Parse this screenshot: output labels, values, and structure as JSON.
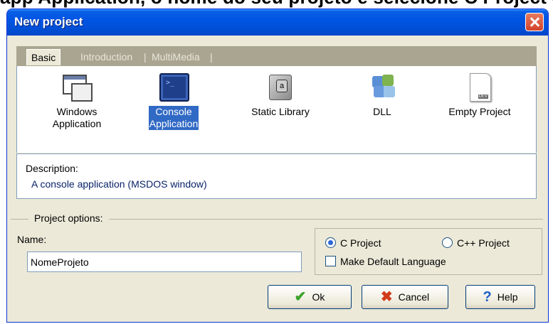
{
  "caption": "app Application, o nome do seu projeto e selecione C Project e clique em OK.",
  "dialog": {
    "title": "New project",
    "tabs": [
      "Basic",
      "Introduction",
      "MultiMedia"
    ],
    "items": [
      {
        "label": "Windows\nApplication",
        "icon": "windows-application-icon"
      },
      {
        "label": "Console\nApplication",
        "icon": "console-application-icon",
        "selected": true
      },
      {
        "label": "Static Library",
        "icon": "static-library-icon"
      },
      {
        "label": "DLL",
        "icon": "puzzle-icon"
      },
      {
        "label": "Empty Project",
        "icon": "empty-document-icon"
      }
    ],
    "description_heading": "Description:",
    "description_text": "A console application (MSDOS window)",
    "options_legend": "Project options:",
    "name_label": "Name:",
    "name_value": "NomeProjeto",
    "c_project_label": "C Project",
    "cpp_project_label": "C++ Project",
    "language_selected": "C Project",
    "make_default_label": "Make Default Language",
    "make_default_checked": false,
    "ok_label": "Ok",
    "cancel_label": "Cancel",
    "help_label": "Help"
  },
  "colors": {
    "titlebar": "#0054e3",
    "selection": "#316ac5",
    "dialog_bg": "#ece9d8"
  }
}
